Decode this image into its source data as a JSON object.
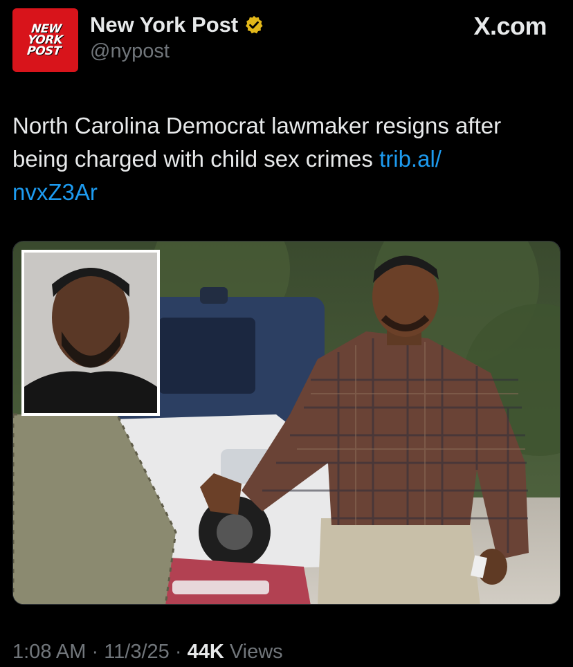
{
  "account": {
    "avatar_text": "NEW\nYORK\nPOST",
    "display_name": "New York Post",
    "handle": "@nypost",
    "verified_badge_color": "#e2b719",
    "avatar_color": "#d8141b"
  },
  "site_label": "X.com",
  "tweet": {
    "text": "North Carolina Democrat lawmaker resigns after being charged with child sex crimes ",
    "link_text": "trib.al/\nnvxZ3Ar",
    "link_color": "#1d9bf0"
  },
  "media": {
    "icon": "photo-with-mugshot-inset"
  },
  "meta": {
    "time": "1:08 AM",
    "separator_1": " · ",
    "date": "11/3/25",
    "separator_2": " · ",
    "views_count": "44K",
    "views_label": " Views"
  }
}
